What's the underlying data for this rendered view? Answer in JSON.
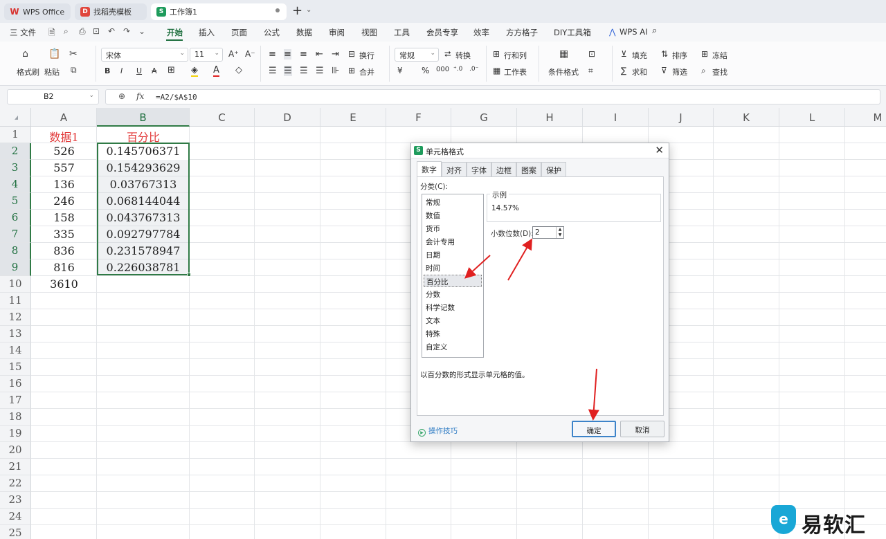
{
  "tabs": {
    "wps": "WPS Office",
    "template": "找稻壳模板",
    "workbook": "工作簿1"
  },
  "menu": {
    "file": "三 文件",
    "items": [
      "开始",
      "插入",
      "页面",
      "公式",
      "数据",
      "审阅",
      "视图",
      "工具",
      "会员专享",
      "效率",
      "方方格子",
      "DIY工具箱"
    ],
    "ai": "WPS AI"
  },
  "ribbon": {
    "format_painter": "格式刷",
    "paste": "粘贴",
    "font_name": "宋体",
    "font_size": "11",
    "wrap": "换行",
    "merge": "合并",
    "number_format": "常规",
    "convert": "转换",
    "row_col": "行和列",
    "worksheet": "工作表",
    "cond_format": "条件格式",
    "fill": "填充",
    "sort": "排序",
    "freeze": "冻结",
    "sum": "求和",
    "filter": "筛选",
    "find": "查找"
  },
  "formula_bar": {
    "cell_ref": "B2",
    "formula": "=A2/$A$10"
  },
  "columns": [
    "A",
    "B",
    "C",
    "D",
    "E",
    "F",
    "G",
    "H",
    "I",
    "J",
    "K",
    "L",
    "M"
  ],
  "rows": [
    "1",
    "2",
    "3",
    "4",
    "5",
    "6",
    "7",
    "8",
    "9",
    "10",
    "11",
    "12",
    "13",
    "14",
    "15",
    "16",
    "17",
    "18",
    "19",
    "20",
    "21",
    "22",
    "23",
    "24",
    "25"
  ],
  "cells": {
    "A": [
      "数据1",
      "526",
      "557",
      "136",
      "246",
      "158",
      "335",
      "836",
      "816",
      "3610"
    ],
    "B": [
      "百分比",
      "0.145706371",
      "0.154293629",
      "0.03767313",
      "0.068144044",
      "0.043767313",
      "0.092797784",
      "0.231578947",
      "0.226038781"
    ]
  },
  "dialog": {
    "title": "单元格格式",
    "tabs": [
      "数字",
      "对齐",
      "字体",
      "边框",
      "图案",
      "保护"
    ],
    "category_label": "分类(C):",
    "categories": [
      "常规",
      "数值",
      "货币",
      "会计专用",
      "日期",
      "时间",
      "百分比",
      "分数",
      "科学记数",
      "文本",
      "特殊",
      "自定义"
    ],
    "selected_category": "百分比",
    "sample_label": "示例",
    "sample_value": "14.57%",
    "decimals_label": "小数位数(D):",
    "decimals_value": "2",
    "description": "以百分数的形式显示单元格的值。",
    "tips": "操作技巧",
    "ok": "确定",
    "cancel": "取消"
  },
  "watermark": "易软汇",
  "colors": {
    "accent": "#1f6f3f",
    "header_red": "#e23b3b",
    "arrow_red": "#e02020",
    "selection": "#2f7a45"
  }
}
